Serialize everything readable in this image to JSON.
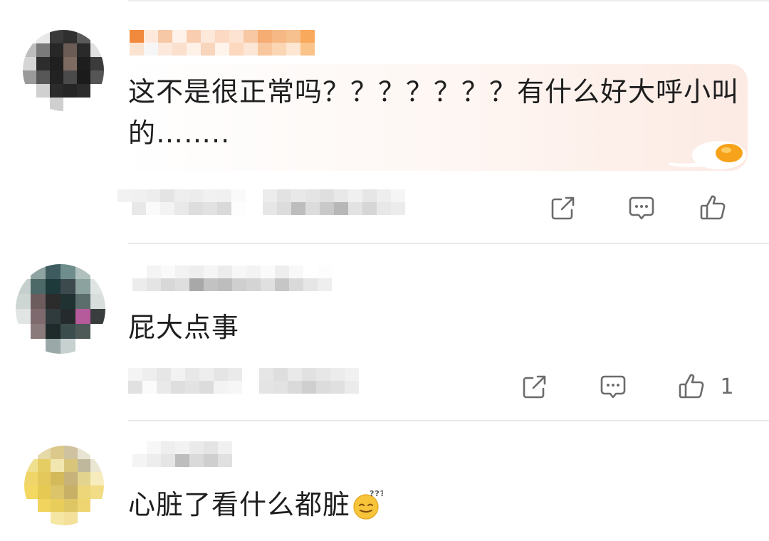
{
  "comments": [
    {
      "text": "这不是很正常吗？？？？？？？有什么好大呼小叫的……..",
      "like_count": "",
      "has_highlight": true
    },
    {
      "text": "屁大点事",
      "like_count": "1"
    },
    {
      "text": "心脏了看什么都脏",
      "emoji": "confused-face-emoji"
    }
  ],
  "actions": {
    "share_icon": "share-icon",
    "reply_icon": "comment-icon",
    "like_icon": "thumbs-up-icon"
  },
  "colors": {
    "text": "#1e1e1e",
    "icon": "#6b6b6b",
    "divider": "#e9e9e9",
    "highlight": "#fce8e0",
    "yolk": "#f6a21a"
  }
}
